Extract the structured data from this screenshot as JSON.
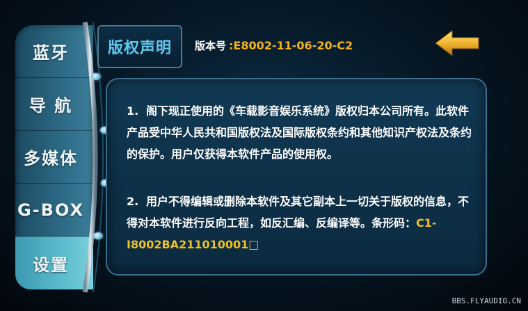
{
  "sidebar": {
    "items": [
      {
        "label": "蓝牙",
        "active": false
      },
      {
        "label": "导 航",
        "active": false
      },
      {
        "label": "多媒体",
        "active": false
      },
      {
        "label": "G-BOX",
        "active": false
      },
      {
        "label": "设置",
        "active": true
      }
    ]
  },
  "header": {
    "title": "版权声明",
    "version_label": "版本号",
    "version_value": ":E8002-11-06-20-C2"
  },
  "content": {
    "clause1_num": "1.",
    "clause1_text": "阁下现正使用的《车载影音娱乐系统》版权归本公司所有。此软件产品受中华人民共和国版权法及国际版权条约和其他知识产权法及条约的保护。用户仅获得本软件产品的使用权。",
    "clause2_num": "2.",
    "clause2_text": "用户不得编辑或删除本软件及其它副本上一切关于版权的信息，不得对本软件进行反向工程，如反汇编、反编译等。条形码：",
    "barcode_value": "C1-I8002BA211010001□"
  },
  "watermark": "BBS.FLYAUDIO.CN",
  "colors": {
    "accent_blue": "#62c9ee",
    "accent_orange": "#f0b323",
    "active_tab": "#62c1d1"
  },
  "icons": {
    "back": "back-arrow-icon"
  }
}
